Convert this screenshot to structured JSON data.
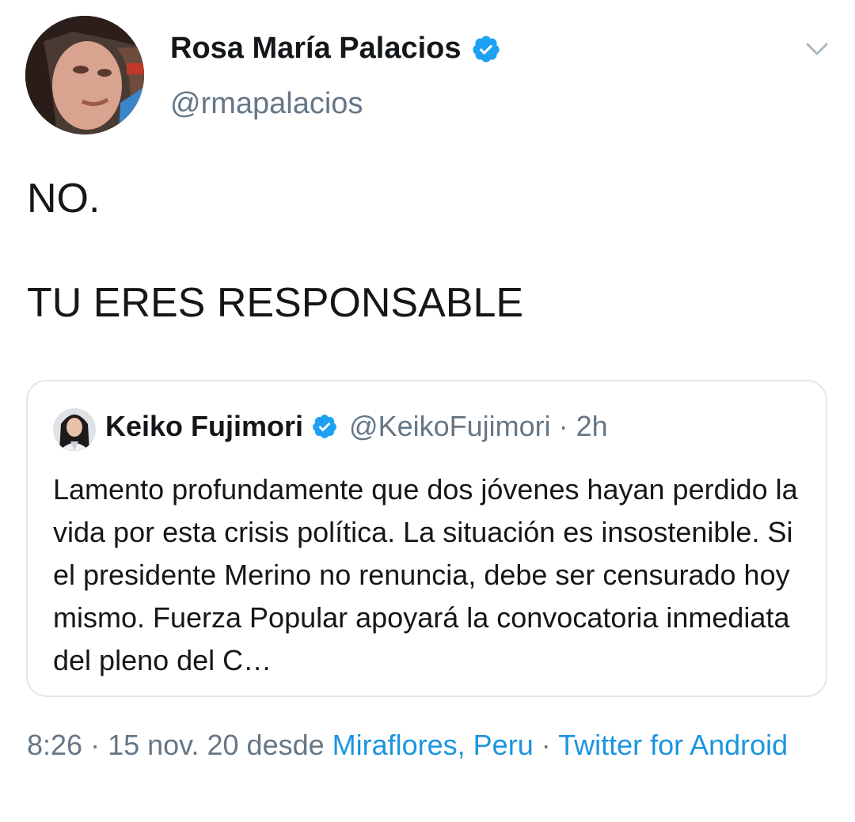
{
  "author": {
    "display_name": "Rosa María Palacios",
    "handle": "@rmapalacios",
    "verified_icon": "verified-badge-icon"
  },
  "tweet": {
    "text": "NO.\n\nTU ERES RESPONSABLE"
  },
  "quoted_tweet": {
    "display_name": "Keiko Fujimori",
    "handle": "@KeikoFujimori",
    "separator": "·",
    "time": "2h",
    "text": "Lamento profundamente que dos jóvenes hayan perdido la vida por esta crisis política. La situación es insostenible. Si el presidente Merino no renuncia, debe ser censurado hoy mismo. Fuerza Popular apoyará la convocatoria inmediata del pleno del C…"
  },
  "metadata": {
    "time": "8:26",
    "separator_1": " · ",
    "date": "15 nov. 20",
    "from_label": " desde ",
    "location": "Miraflores, Peru",
    "separator_2": " · ",
    "source": "Twitter for Android"
  },
  "colors": {
    "link": "#1b95e0",
    "verified": "#1da1f2",
    "secondary_text": "#657786",
    "border": "#e1e8ed"
  }
}
